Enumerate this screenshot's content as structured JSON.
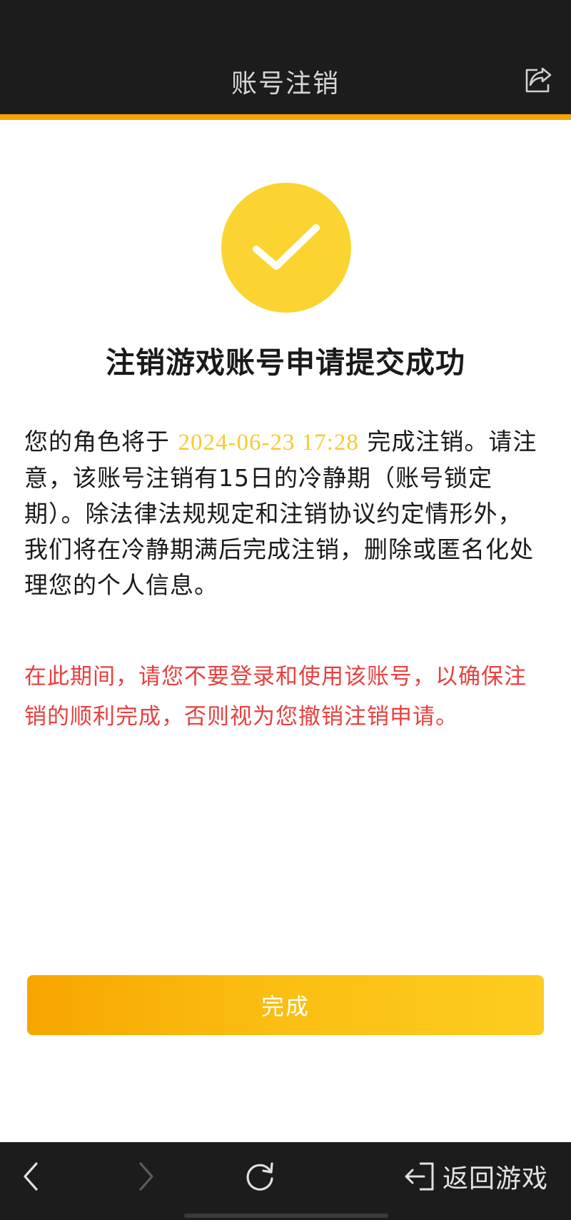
{
  "header": {
    "title": "账号注销",
    "share_icon": "share-icon"
  },
  "colors": {
    "header_bg": "#1c1c1c",
    "accent_rule": "#f5a400",
    "success_circle": "#fcd431",
    "date_highlight": "#f4cb33",
    "warning_text": "#e8403f",
    "button_gradient": [
      "#f7a600",
      "#fdcc20"
    ]
  },
  "main": {
    "success_icon": "checkmark-icon",
    "title": "注销游戏账号申请提交成功",
    "notice": {
      "before_date": "您的角色将于 ",
      "date": "2024-06-23 17:28",
      "after_date": " 完成注销。请注意，该账号注销有15日的冷静期（账号锁定期）。除法律法规规定和注销协议约定情形外，我们将在冷静期满后完成注销，删除或匿名化处理您的个人信息。"
    },
    "warning": "在此期间，请您不要登录和使用该账号，以确保注销的顺利完成，否则视为您撤销注销申请。",
    "done_button": "完成"
  },
  "bottom_bar": {
    "back_icon": "chevron-left-icon",
    "forward_icon": "chevron-right-icon",
    "refresh_icon": "refresh-icon",
    "return_icon": "exit-icon",
    "return_label": "返回游戏"
  }
}
